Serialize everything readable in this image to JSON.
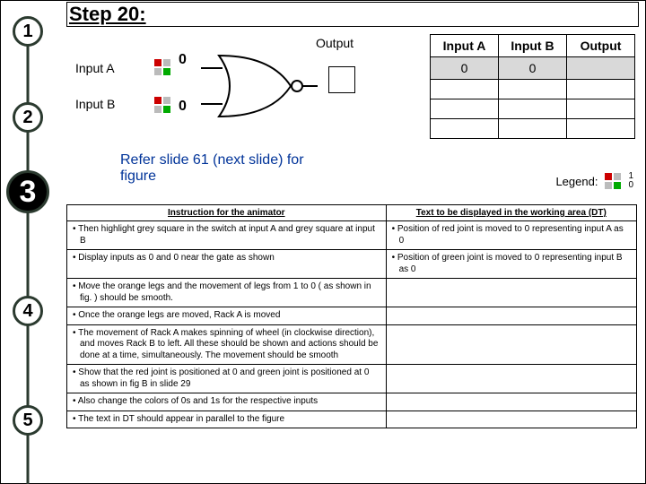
{
  "title": "Step 20:",
  "steps": [
    "1",
    "2",
    "3",
    "4",
    "5"
  ],
  "current_step_index": 2,
  "gate": {
    "inputA_label": "Input A",
    "inputB_label": "Input B",
    "output_label": "Output",
    "valA": "0",
    "valB": "0"
  },
  "truth_table": {
    "headers": [
      "Input A",
      "Input B",
      "Output"
    ],
    "rows": [
      [
        "0",
        "0",
        ""
      ],
      [
        "",
        "",
        ""
      ],
      [
        "",
        "",
        ""
      ],
      [
        "",
        "",
        ""
      ]
    ]
  },
  "refer_text": "Refer slide 61 (next slide) for figure",
  "legend": {
    "label": "Legend:",
    "one": "1",
    "zero": "0"
  },
  "instr": {
    "head_left": "Instruction for the animator",
    "head_right": "Text to be displayed in the working area (DT)",
    "r1l": "• Then highlight grey square in the switch at input A and grey square at input B",
    "r1r": "• Position of  red joint is moved to 0 representing input A as 0",
    "r2l": "• Display inputs as 0 and 0 near the gate as shown",
    "r2r": "• Position of  green joint is moved to 0 representing input B as 0",
    "r3l": "• Move the orange legs  and the movement of  legs from 1 to 0 ( as shown in fig. ) should be smooth.",
    "r4l": "• Once the orange legs are moved, Rack A is moved",
    "r5l": "• The movement of Rack A makes spinning of wheel (in clockwise direction),  and moves Rack B to left. All these should be shown and  actions should be done at a time, simultaneously. The movement should be smooth",
    "r6l": "• Show  that the red joint is positioned at 0 and green joint is positioned at 0 as shown in fig B in slide 29",
    "r7l": "•  Also change the colors of 0s and 1s for the respective inputs",
    "r8l": "• The text in DT should appear  in parallel to the figure"
  },
  "chart_data": {
    "type": "table",
    "title": "NOR gate truth table (partial, step 20)",
    "headers": [
      "Input A",
      "Input B",
      "Output"
    ],
    "rows": [
      {
        "Input A": 0,
        "Input B": 0,
        "Output": null
      },
      {
        "Input A": null,
        "Input B": null,
        "Output": null
      },
      {
        "Input A": null,
        "Input B": null,
        "Output": null
      },
      {
        "Input A": null,
        "Input B": null,
        "Output": null
      }
    ]
  }
}
